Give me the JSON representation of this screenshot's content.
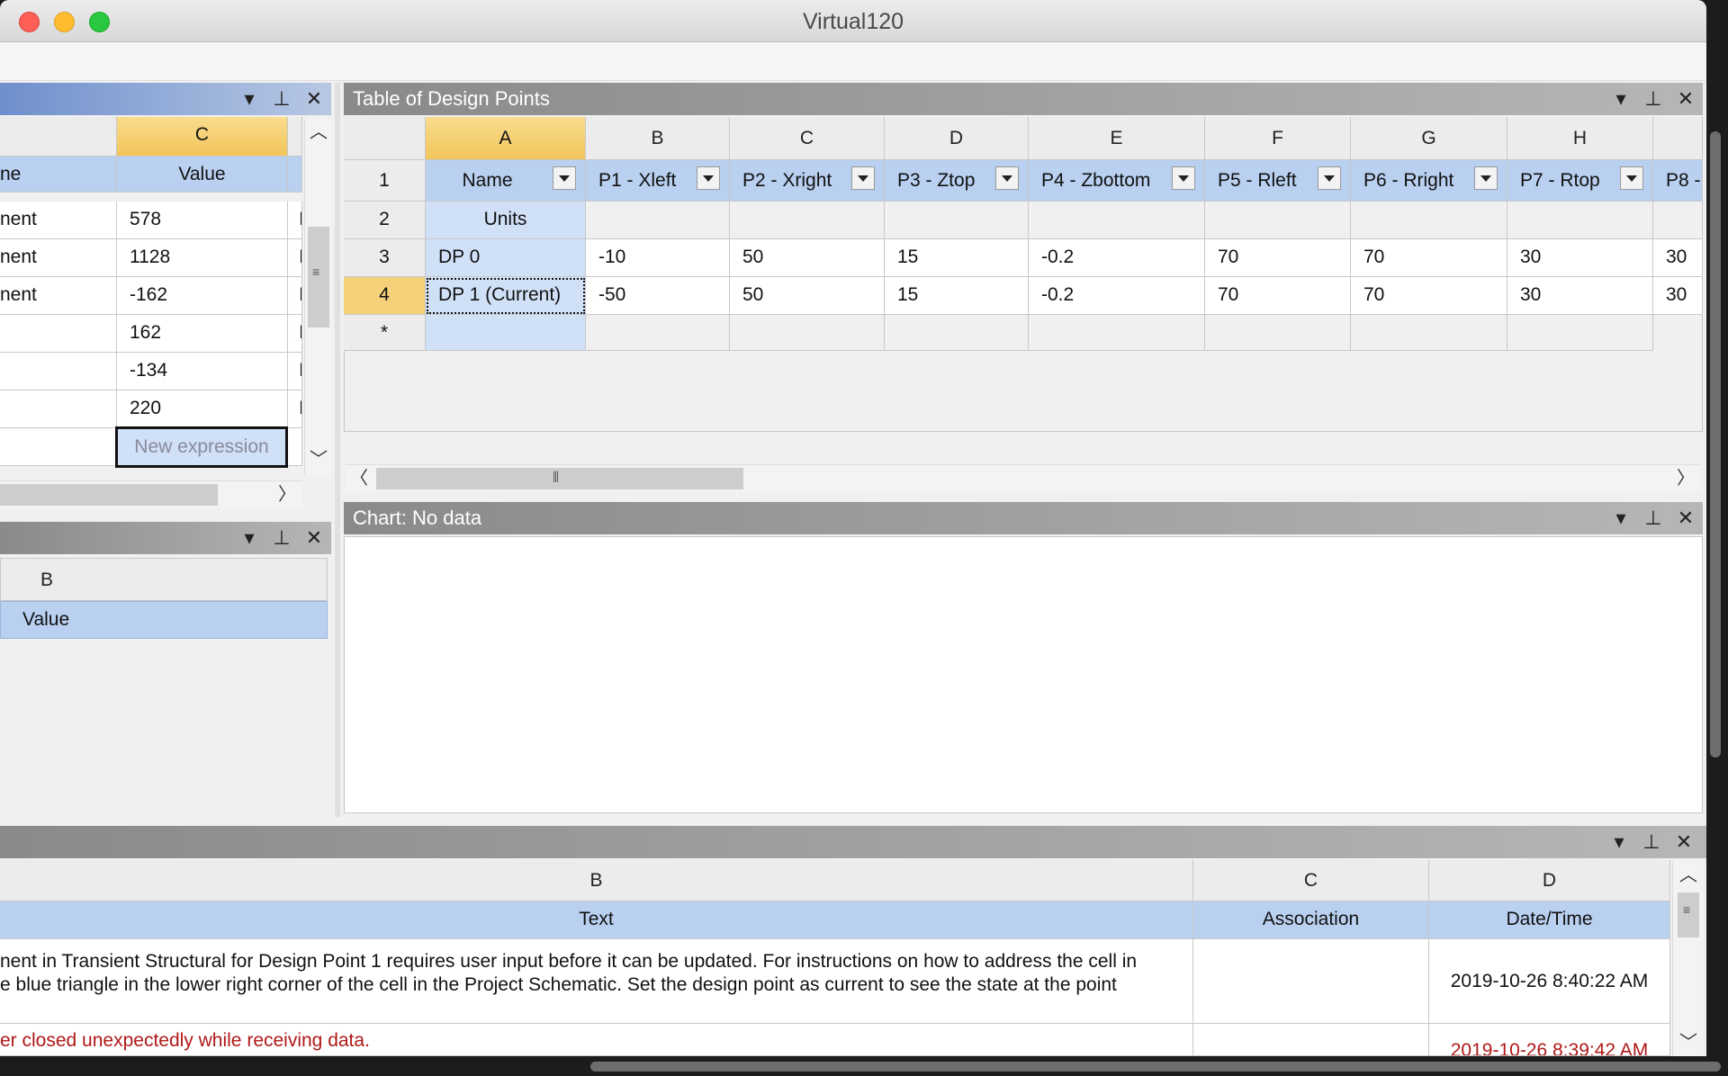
{
  "window": {
    "title": "Virtual120"
  },
  "left_top_panel": {
    "col_header": "C",
    "value_header": "Value",
    "name_header_fragment": "ne",
    "rows": [
      {
        "name": "nent",
        "value": "578",
        "unit": "I"
      },
      {
        "name": "nent",
        "value": "1128",
        "unit": "I"
      },
      {
        "name": "nent",
        "value": "-162",
        "unit": "I"
      },
      {
        "name": "",
        "value": "162",
        "unit": "I"
      },
      {
        "name": "",
        "value": "-134",
        "unit": "I"
      },
      {
        "name": "",
        "value": "220",
        "unit": "I"
      }
    ],
    "new_expression_placeholder": "New expression"
  },
  "left_bottom_panel": {
    "col_header": "B",
    "value_header": "Value"
  },
  "design_points": {
    "title": "Table of Design Points",
    "col_letters": [
      "A",
      "B",
      "C",
      "D",
      "E",
      "F",
      "G",
      "H"
    ],
    "row_numbers": [
      "1",
      "2",
      "3",
      "4",
      "*"
    ],
    "headers": [
      "Name",
      "P1 - Xleft",
      "P2 - Xright",
      "P3 - Ztop",
      "P4 - Zbottom",
      "P5 - Rleft",
      "P6 - Rright",
      "P7 - Rtop",
      "P8 -"
    ],
    "units_label": "Units",
    "rows": [
      [
        "DP 0",
        "-10",
        "50",
        "15",
        "-0.2",
        "70",
        "70",
        "30",
        "30"
      ],
      [
        "DP 1 (Current)",
        "-50",
        "50",
        "15",
        "-0.2",
        "70",
        "70",
        "30",
        "30"
      ]
    ]
  },
  "chart_panel": {
    "title": "Chart: No data"
  },
  "messages_panel": {
    "col_letters": [
      "B",
      "C",
      "D"
    ],
    "headers": [
      "Text",
      "Association",
      "Date/Time"
    ],
    "messages": [
      {
        "line1": "nent in Transient Structural for Design Point 1 requires user input before it can be updated. For instructions on how to address the cell in",
        "line2": "e blue triangle in the lower right corner of the cell in the Project Schematic. Set the design point as current to see the state at the point",
        "association": "",
        "datetime": "2019-10-26 8:40:22 AM"
      },
      {
        "line1": "er closed unexpectedly while receiving data.",
        "association": "",
        "datetime": "2019-10-26 8:39:42 AM"
      }
    ]
  },
  "colors": {
    "accent_selected": "#f2c55a",
    "header_blue": "#b9d0f0",
    "error_text": "#b01818"
  },
  "icons": [
    "dropdown-arrow-icon",
    "pin-icon",
    "close-icon",
    "scroll-up-icon",
    "scroll-down-icon",
    "scroll-left-icon",
    "scroll-right-icon",
    "grip-icon"
  ]
}
